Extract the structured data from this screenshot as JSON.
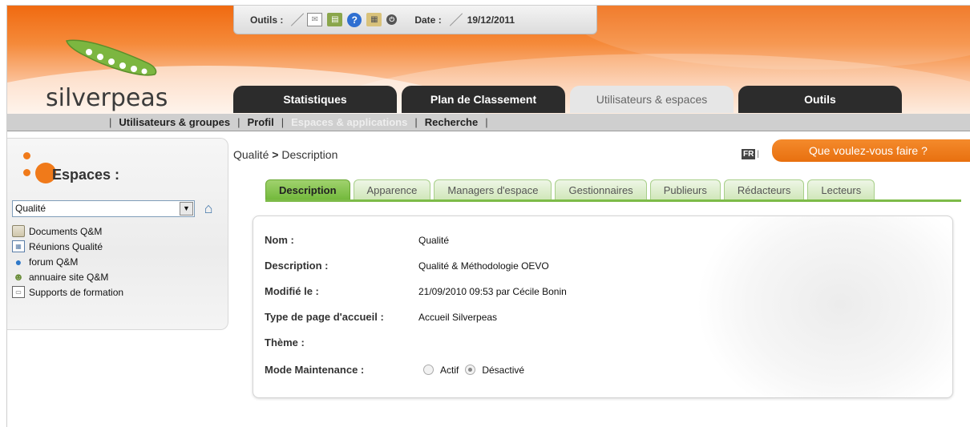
{
  "toolbar": {
    "tools_label": "Outils :",
    "icons": [
      "mail-icon",
      "news-icon",
      "help-icon",
      "clipboard-icon",
      "power-icon"
    ],
    "date_label": "Date :",
    "date_value": "19/12/2011"
  },
  "logo": {
    "text": "silverpeas"
  },
  "main_tabs": [
    {
      "label": "Statistiques",
      "active": false
    },
    {
      "label": "Plan de Classement",
      "active": false
    },
    {
      "label": "Utilisateurs & espaces",
      "active": true
    },
    {
      "label": "Outils",
      "active": false
    }
  ],
  "subnav": [
    {
      "label": "Utilisateurs & groupes",
      "active": true
    },
    {
      "label": "Profil",
      "active": true
    },
    {
      "label": "Espaces & applications",
      "active": false
    },
    {
      "label": "Recherche",
      "active": true
    }
  ],
  "left": {
    "title": "Espaces :",
    "selected_space": "Qualité",
    "apps": [
      {
        "label": "Documents Q&M",
        "icon": "folder-icon"
      },
      {
        "label": "Réunions Qualité",
        "icon": "calendar-icon"
      },
      {
        "label": "forum Q&M",
        "icon": "forum-icon"
      },
      {
        "label": "annuaire site Q&M",
        "icon": "directory-icon"
      },
      {
        "label": "Supports de formation",
        "icon": "documents-icon"
      }
    ]
  },
  "breadcrumb": {
    "space": "Qualité",
    "sep": " > ",
    "page": "Description"
  },
  "lang": {
    "code": "FR",
    "bar": "|"
  },
  "action_button": "Que voulez-vous faire ?",
  "content_tabs": [
    {
      "label": "Description",
      "active": true
    },
    {
      "label": "Apparence",
      "active": false
    },
    {
      "label": "Managers d'espace",
      "active": false
    },
    {
      "label": "Gestionnaires",
      "active": false
    },
    {
      "label": "Publieurs",
      "active": false
    },
    {
      "label": "Rédacteurs",
      "active": false
    },
    {
      "label": "Lecteurs",
      "active": false
    }
  ],
  "details": {
    "nom_label": "Nom :",
    "nom_value": "Qualité",
    "description_label": "Description :",
    "description_value": "Qualité & Méthodologie OEVO",
    "modified_label": "Modifié le :",
    "modified_value": "21/09/2010 09:53 par Cécile Bonin",
    "homepage_label": "Type de page d'accueil :",
    "homepage_value": "Accueil Silverpeas",
    "theme_label": "Thème :",
    "theme_value": "",
    "maintenance_label": "Mode Maintenance :",
    "maintenance_options": [
      {
        "label": "Actif",
        "checked": false
      },
      {
        "label": "Désactivé",
        "checked": true
      }
    ]
  },
  "colors": {
    "brand_orange": "#f06a10",
    "tab_dark": "#2c2c2c",
    "tab_green": "#72b83a"
  }
}
